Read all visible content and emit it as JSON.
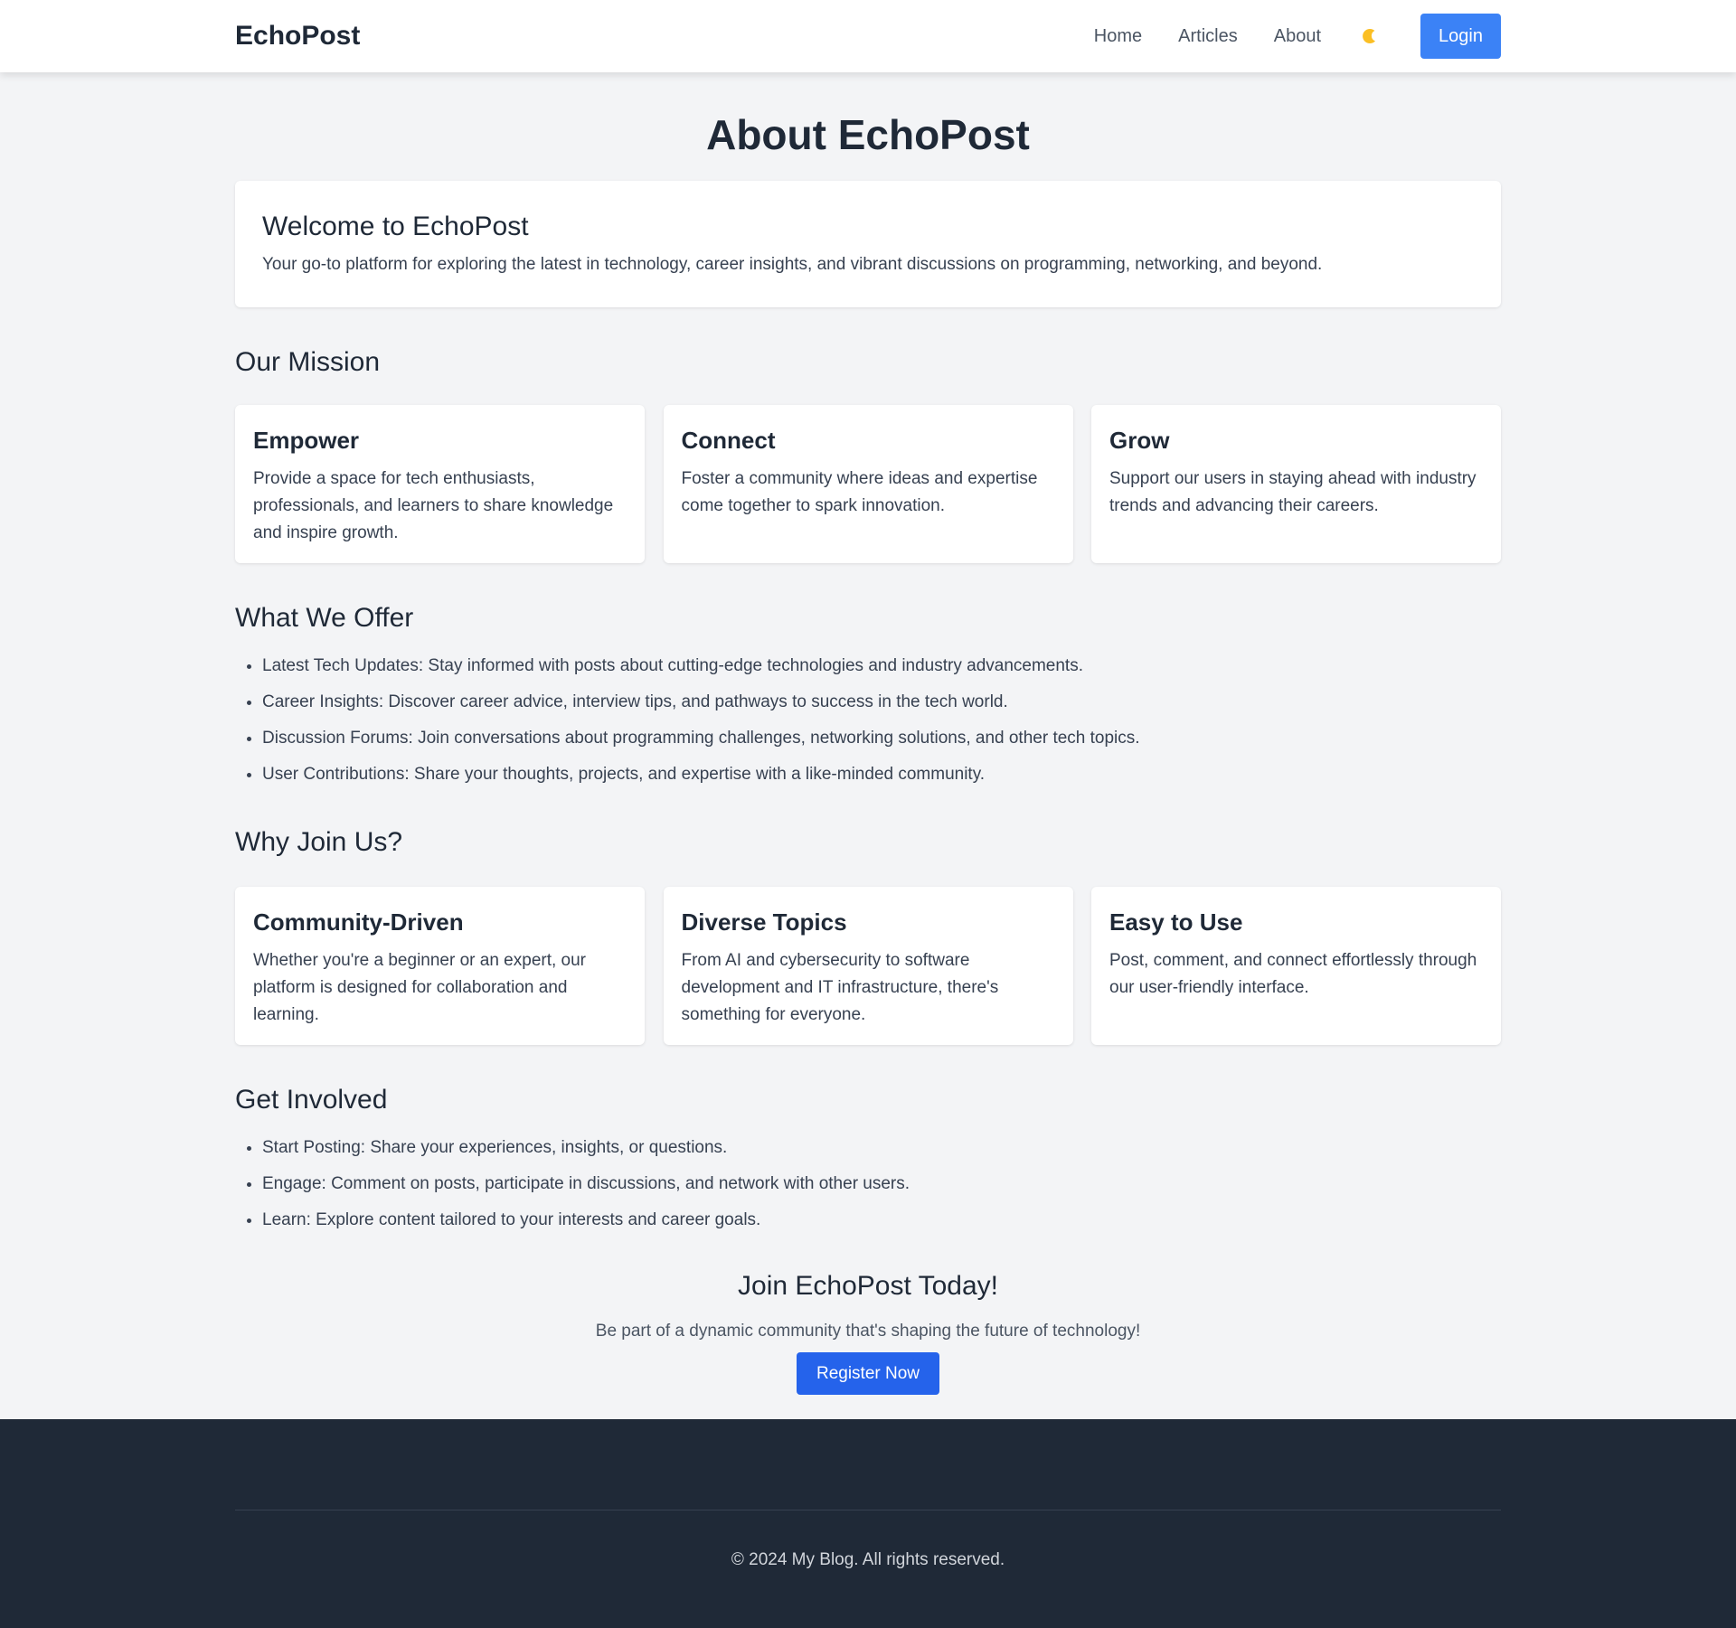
{
  "nav": {
    "brand": "EchoPost",
    "links": [
      "Home",
      "Articles",
      "About"
    ],
    "login_label": "Login"
  },
  "colors": {
    "accent": "#3b82f6",
    "register": "#2563eb",
    "footer_bg": "#1f2937",
    "page_bg": "#f3f4f6",
    "moon": "#fbbf24"
  },
  "page_title": "About EchoPost",
  "welcome": {
    "title": "Welcome to EchoPost",
    "text": "Your go-to platform for exploring the latest in technology, career insights, and vibrant discussions on programming, networking, and beyond."
  },
  "mission": {
    "title": "Our Mission",
    "cards": [
      {
        "title": "Empower",
        "text": "Provide a space for tech enthusiasts, professionals, and learners to share knowledge and inspire growth."
      },
      {
        "title": "Connect",
        "text": "Foster a community where ideas and expertise come together to spark innovation."
      },
      {
        "title": "Grow",
        "text": "Support our users in staying ahead with industry trends and advancing their careers."
      }
    ]
  },
  "offer": {
    "title": "What We Offer",
    "items": [
      "Latest Tech Updates: Stay informed with posts about cutting-edge technologies and industry advancements.",
      "Career Insights: Discover career advice, interview tips, and pathways to success in the tech world.",
      "Discussion Forums: Join conversations about programming challenges, networking solutions, and other tech topics.",
      "User Contributions: Share your thoughts, projects, and expertise with a like-minded community."
    ]
  },
  "why": {
    "title": "Why Join Us?",
    "cards": [
      {
        "title": "Community-Driven",
        "text": "Whether you're a beginner or an expert, our platform is designed for collaboration and learning."
      },
      {
        "title": "Diverse Topics",
        "text": "From AI and cybersecurity to software development and IT infrastructure, there's something for everyone."
      },
      {
        "title": "Easy to Use",
        "text": "Post, comment, and connect effortlessly through our user-friendly interface."
      }
    ]
  },
  "involved": {
    "title": "Get Involved",
    "items": [
      "Start Posting: Share your experiences, insights, or questions.",
      "Engage: Comment on posts, participate in discussions, and network with other users.",
      "Learn: Explore content tailored to your interests and career goals."
    ]
  },
  "cta": {
    "title": "Join EchoPost Today!",
    "text": "Be part of a dynamic community that's shaping the future of technology!",
    "button": "Register Now"
  },
  "footer": {
    "copyright": "© 2024 My Blog. All rights reserved."
  }
}
